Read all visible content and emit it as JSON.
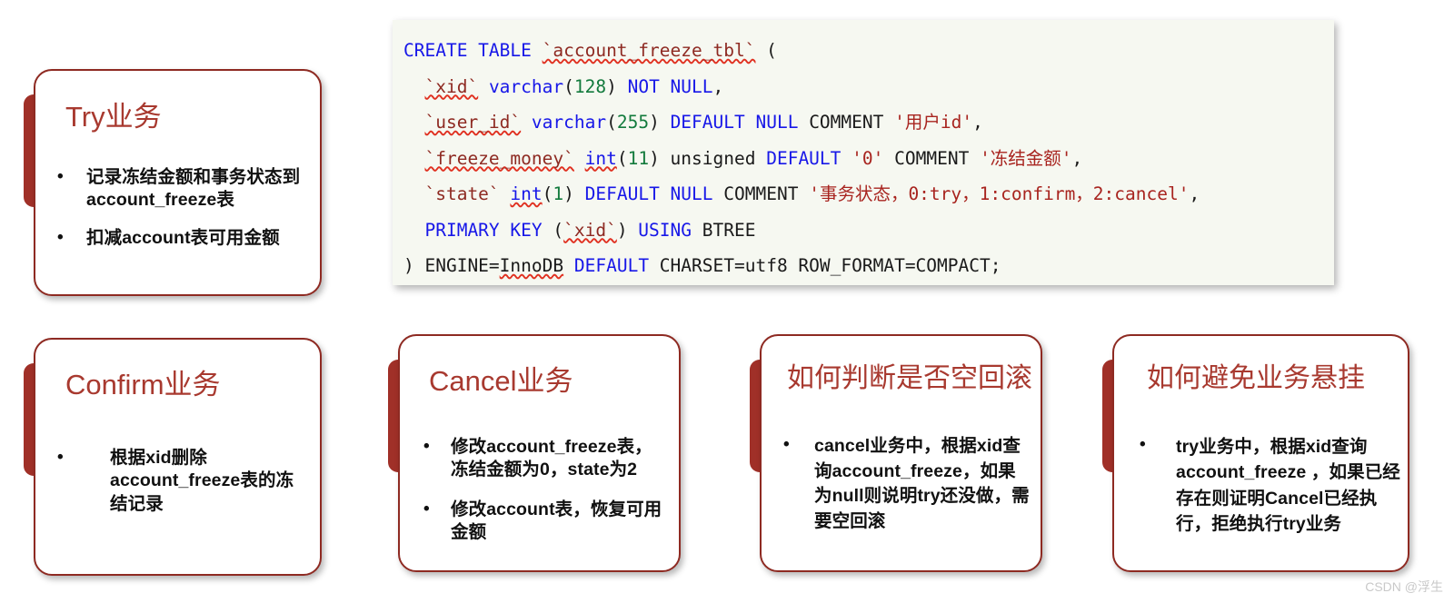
{
  "cards": [
    {
      "id": "try",
      "title": "Try业务",
      "bullets": [
        "记录冻结金额和事务状态到account_freeze表",
        "扣减account表可用金额"
      ]
    },
    {
      "id": "confirm",
      "title": "Confirm业务",
      "bullets": [
        "根据xid删除account_freeze表的冻结记录"
      ]
    },
    {
      "id": "cancel",
      "title": "Cancel业务",
      "bullets": [
        "修改account_freeze表，冻结金额为0，state为2",
        "修改account表，恢复可用金额"
      ]
    },
    {
      "id": "empty-rollback",
      "title": "如何判断是否空回滚",
      "bullets": [
        "cancel业务中，根据xid查询account_freeze，如果为null则说明try还没做，需要空回滚"
      ]
    },
    {
      "id": "hanging",
      "title": "如何避免业务悬挂",
      "bullets": [
        "try业务中，根据xid查询account_freeze ，如果已经存在则证明Cancel已经执行，拒绝执行try业务"
      ]
    }
  ],
  "sql": {
    "language": "sql",
    "full_text": "CREATE TABLE `account_freeze_tbl` (\n  `xid` varchar(128) NOT NULL,\n  `user_id` varchar(255) DEFAULT NULL COMMENT '用户id',\n  `freeze_money` int(11) unsigned DEFAULT '0' COMMENT '冻结金额',\n  `state` int(1) DEFAULT NULL COMMENT '事务状态，0:try，1:confirm，2:cancel',\n  PRIMARY KEY (`xid`) USING BTREE\n) ENGINE=InnoDB DEFAULT CHARSET=utf8 ROW_FORMAT=COMPACT;",
    "lines": [
      {
        "id": "line-create-table",
        "tokens": [
          {
            "t": "CREATE TABLE ",
            "c": "kw"
          },
          {
            "t": "`account_freeze_tbl`",
            "c": "id sq"
          },
          {
            "t": " (",
            "c": ""
          }
        ]
      },
      {
        "id": "line-xid",
        "tokens": [
          {
            "t": "  ",
            "c": ""
          },
          {
            "t": "`xid`",
            "c": "id sq"
          },
          {
            "t": " ",
            "c": ""
          },
          {
            "t": "varchar",
            "c": "kw"
          },
          {
            "t": "(",
            "c": ""
          },
          {
            "t": "128",
            "c": "num"
          },
          {
            "t": ") ",
            "c": ""
          },
          {
            "t": "NOT NULL",
            "c": "kw"
          },
          {
            "t": ",",
            "c": ""
          }
        ]
      },
      {
        "id": "line-user-id",
        "tokens": [
          {
            "t": "  ",
            "c": ""
          },
          {
            "t": "`user_id`",
            "c": "id sq"
          },
          {
            "t": " ",
            "c": ""
          },
          {
            "t": "varchar",
            "c": "kw"
          },
          {
            "t": "(",
            "c": ""
          },
          {
            "t": "255",
            "c": "num"
          },
          {
            "t": ") ",
            "c": ""
          },
          {
            "t": "DEFAULT NULL",
            "c": "kw"
          },
          {
            "t": " COMMENT ",
            "c": ""
          },
          {
            "t": "'用户id'",
            "c": "str"
          },
          {
            "t": ",",
            "c": ""
          }
        ]
      },
      {
        "id": "line-freeze-money",
        "tokens": [
          {
            "t": "  ",
            "c": ""
          },
          {
            "t": "`freeze_money`",
            "c": "id sq"
          },
          {
            "t": " ",
            "c": ""
          },
          {
            "t": "int",
            "c": "kw sq"
          },
          {
            "t": "(",
            "c": ""
          },
          {
            "t": "11",
            "c": "num"
          },
          {
            "t": ") unsigned ",
            "c": ""
          },
          {
            "t": "DEFAULT",
            "c": "kw"
          },
          {
            "t": " ",
            "c": ""
          },
          {
            "t": "'0'",
            "c": "str"
          },
          {
            "t": " COMMENT ",
            "c": ""
          },
          {
            "t": "'冻结金额'",
            "c": "str"
          },
          {
            "t": ",",
            "c": ""
          }
        ]
      },
      {
        "id": "line-state",
        "tokens": [
          {
            "t": "  ",
            "c": ""
          },
          {
            "t": "`state`",
            "c": "id"
          },
          {
            "t": " ",
            "c": ""
          },
          {
            "t": "int",
            "c": "kw sq"
          },
          {
            "t": "(",
            "c": ""
          },
          {
            "t": "1",
            "c": "num"
          },
          {
            "t": ") ",
            "c": ""
          },
          {
            "t": "DEFAULT NULL",
            "c": "kw"
          },
          {
            "t": " COMMENT ",
            "c": ""
          },
          {
            "t": "'事务状态，0:try，1:confirm，2:cancel'",
            "c": "str"
          },
          {
            "t": ",",
            "c": ""
          }
        ]
      },
      {
        "id": "line-primary-key",
        "tokens": [
          {
            "t": "  ",
            "c": ""
          },
          {
            "t": "PRIMARY KEY",
            "c": "kw"
          },
          {
            "t": " (",
            "c": ""
          },
          {
            "t": "`xid`",
            "c": "id sq"
          },
          {
            "t": ") ",
            "c": ""
          },
          {
            "t": "USING",
            "c": "kw"
          },
          {
            "t": " BTREE",
            "c": ""
          }
        ]
      },
      {
        "id": "line-engine",
        "tokens": [
          {
            "t": ") ENGINE=",
            "c": ""
          },
          {
            "t": "InnoDB",
            "c": "sq"
          },
          {
            "t": " ",
            "c": ""
          },
          {
            "t": "DEFAULT",
            "c": "kw"
          },
          {
            "t": " CHARSET=utf8 ROW_FORMAT=COMPACT;",
            "c": ""
          }
        ]
      }
    ]
  },
  "watermark": "CSDN @浮生",
  "colors": {
    "accent_tab": "#A03028",
    "card_border": "#8E2A22",
    "card_title": "#A8392F",
    "code_bg": "#F6F8F1",
    "keyword": "#1717E8",
    "number": "#127A3C",
    "identifier": "#8E2A22",
    "string": "#A8241F",
    "squiggle": "#E03020",
    "watermark": "#C9C9C9"
  }
}
